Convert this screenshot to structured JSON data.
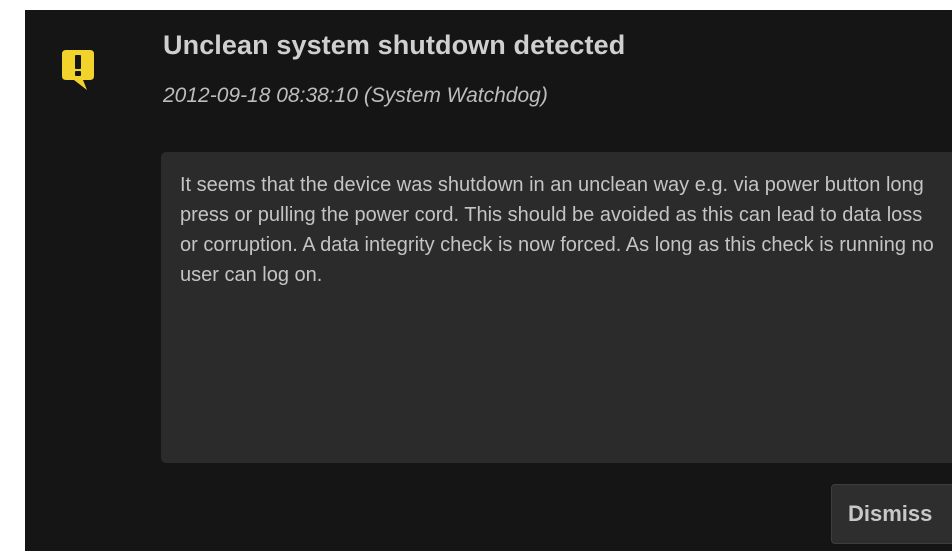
{
  "notification": {
    "icon": "alert-warning-icon",
    "accent_color": "#f2d32b",
    "title": "Unclean system shutdown detected",
    "timestamp": "2012-09-18 08:38:10",
    "source": "(System Watchdog)",
    "meta_line": "2012-09-18 08:38:10 (System Watchdog)",
    "message": "It seems that the device was shutdown in an unclean way e.g. via power button long press or pulling the power cord. This should be avoided as this can lead to data loss or corruption. A data integrity check is now forced. As long as this check is running no user can log on.",
    "dismiss_label": "Dismiss"
  }
}
